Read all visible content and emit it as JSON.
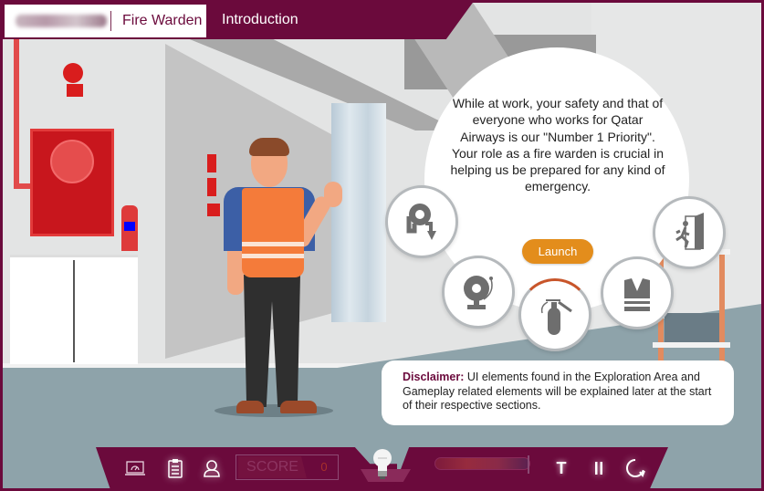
{
  "header": {
    "logo_alt": "Qatar Airways logo",
    "course_title": "Fire Warden",
    "section_title": "Introduction"
  },
  "intro": {
    "message": "While at work, your safety and that of everyone who works for Qatar Airways is our \"Number 1 Priority\". Your role as a fire warden is crucial in helping us be prepared for any kind of emergency.",
    "launch_label": "Launch"
  },
  "topics": [
    {
      "id": "hose",
      "icon": "fire-hose-reel-icon"
    },
    {
      "id": "alarm",
      "icon": "fire-alarm-bell-icon"
    },
    {
      "id": "extinguisher",
      "icon": "fire-extinguisher-icon"
    },
    {
      "id": "vest",
      "icon": "safety-vest-icon"
    },
    {
      "id": "exit",
      "icon": "emergency-exit-icon"
    }
  ],
  "disclaimer": {
    "label": "Disclaimer:",
    "text": " UI elements found in the Exploration Area and Gameplay related elements will be explained later at the start of their respective sections."
  },
  "bottombar": {
    "dashboard_icon": "laptop-dashboard-icon",
    "tasks_icon": "clipboard-checklist-icon",
    "profile_icon": "user-icon",
    "score_label": "SCORE",
    "score_value": "0",
    "hint_icon": "lightbulb-icon",
    "progress": 0.97,
    "text_button": "T",
    "pause_icon": "pause-icon",
    "replay_icon": "replay-icon"
  },
  "colors": {
    "brand": "#6b0a3c",
    "accent": "#e38d1c",
    "icon_gray": "#6e6e6e"
  }
}
